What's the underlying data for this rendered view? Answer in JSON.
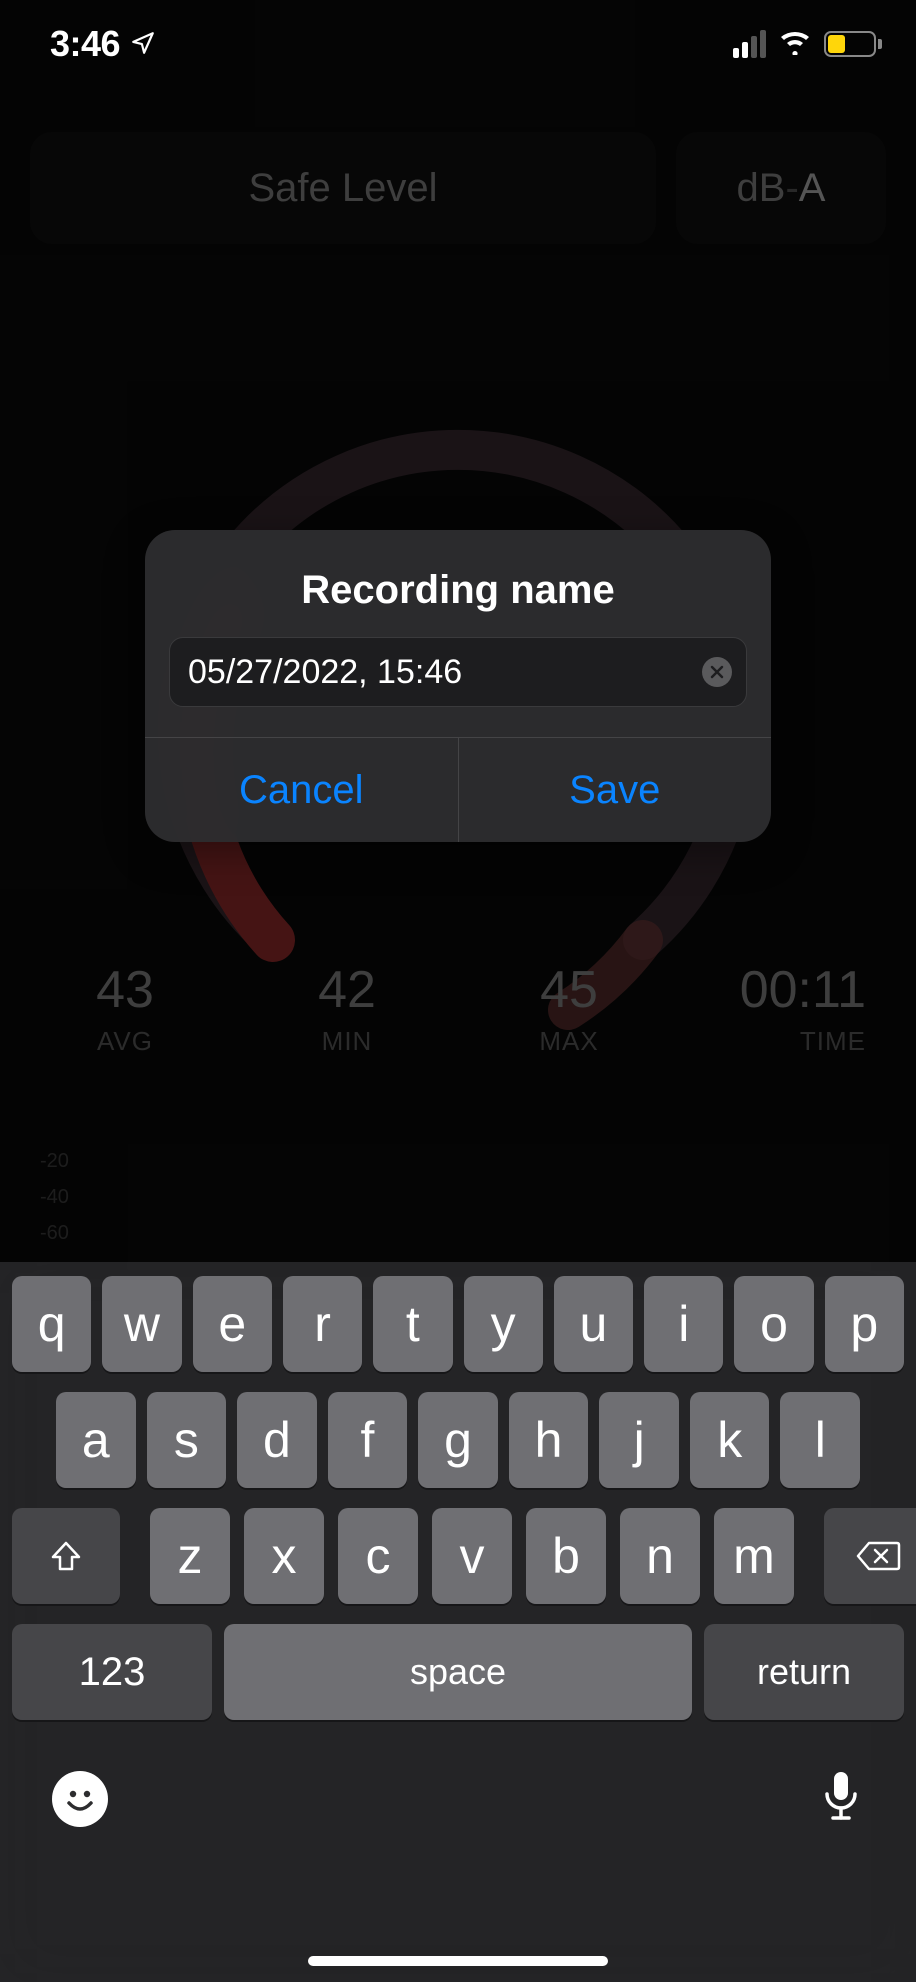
{
  "status_bar": {
    "time": "3:46",
    "battery_percent": 35
  },
  "top": {
    "safe_level_label": "Safe Level",
    "unit_prefix": "dB",
    "unit_dash": "-",
    "unit_suffix": "A"
  },
  "stats": {
    "avg": {
      "value": "43",
      "label": "AVG"
    },
    "min": {
      "value": "42",
      "label": "MIN"
    },
    "max": {
      "value": "45",
      "label": "MAX"
    },
    "time": {
      "value": "00:11",
      "label": "TIME"
    }
  },
  "waveform_ticks": [
    "-20",
    "-40",
    "-60"
  ],
  "alert": {
    "title": "Recording name",
    "input_value": "05/27/2022, 15:46",
    "cancel_label": "Cancel",
    "save_label": "Save"
  },
  "keyboard": {
    "row1": [
      "q",
      "w",
      "e",
      "r",
      "t",
      "y",
      "u",
      "i",
      "o",
      "p"
    ],
    "row2": [
      "a",
      "s",
      "d",
      "f",
      "g",
      "h",
      "j",
      "k",
      "l"
    ],
    "row3": [
      "z",
      "x",
      "c",
      "v",
      "b",
      "n",
      "m"
    ],
    "numbers_label": "123",
    "space_label": "space",
    "return_label": "return"
  }
}
